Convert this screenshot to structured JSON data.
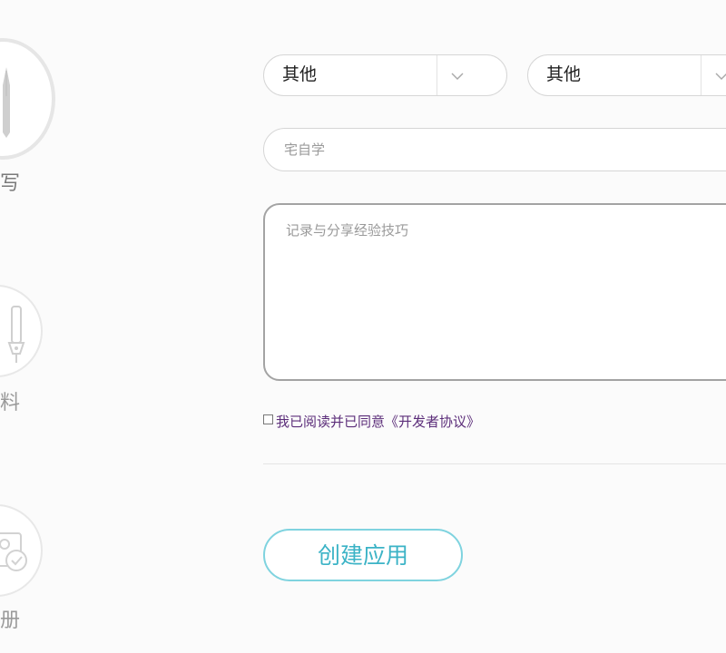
{
  "steps": [
    {
      "label": "填写",
      "icon": "pen-nib-icon"
    },
    {
      "label": "资料",
      "icon": "pen-icon"
    },
    {
      "label": "注册",
      "icon": "badge-check-icon"
    }
  ],
  "form": {
    "category_primary": {
      "value": "其他"
    },
    "category_secondary": {
      "value": "其他"
    },
    "name_input": {
      "placeholder": "宅自学"
    },
    "description": {
      "placeholder": "记录与分享经验技巧"
    },
    "agreement": {
      "text": "我已阅读并已同意《开发者协议》",
      "checked": false
    },
    "submit_label": "创建应用"
  },
  "colors": {
    "accent": "#3bb3c6",
    "accent_border": "#7fd3df",
    "link": "#5c2e7a"
  }
}
